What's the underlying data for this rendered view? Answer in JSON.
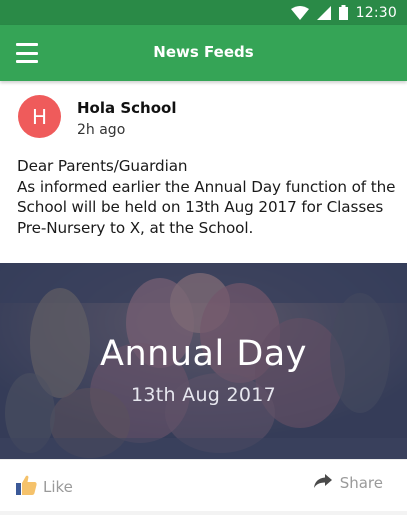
{
  "status_bar": {
    "time": "12:30"
  },
  "app_bar": {
    "title": "News Feeds"
  },
  "post": {
    "avatar_letter": "H",
    "author": "Hola School",
    "time_ago": "2h ago",
    "text": "Dear Parents/Guardian\nAs informed earlier the Annual Day function of the School will be held on 13th Aug 2017 for Classes Pre-Nursery to X, at the School.",
    "image": {
      "title": "Annual Day",
      "date": "13th Aug 2017"
    }
  },
  "actions": {
    "like_label": "Like",
    "share_label": "Share"
  },
  "colors": {
    "status_bar": "#2a8a47",
    "app_bar": "#35a456",
    "avatar": "#ef5b5b",
    "like_icon": "#3b5998"
  },
  "icons": [
    "wifi-icon",
    "signal-icon",
    "battery-icon",
    "menu-icon",
    "like-icon",
    "share-icon"
  ]
}
